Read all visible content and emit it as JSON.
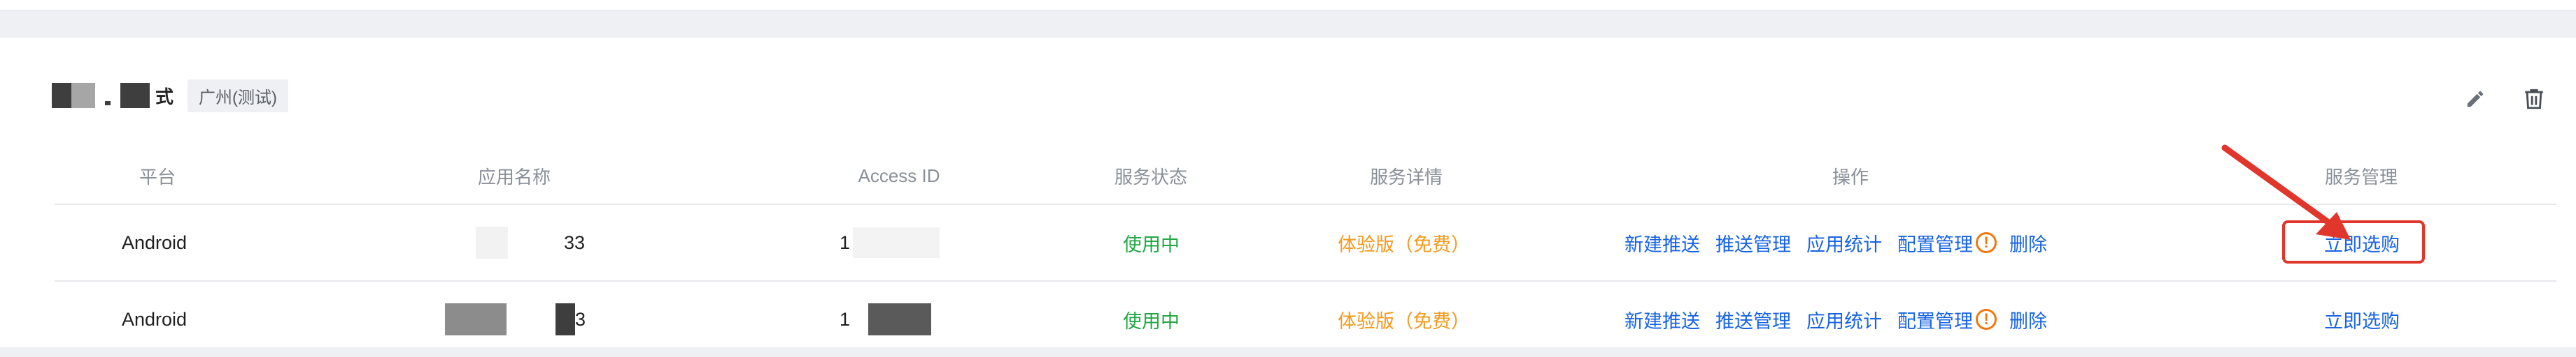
{
  "card": {
    "title_suffix": "式",
    "region_tag": "广州(测试)"
  },
  "table": {
    "headers": [
      "平台",
      "应用名称",
      "Access ID",
      "服务状态",
      "服务详情",
      "操作",
      "服务管理"
    ],
    "rows": [
      {
        "platform": "Android",
        "app_name_visible": "33",
        "access_id_visible": "1",
        "status": "使用中",
        "detail": "体验版（免费）",
        "ops": [
          "新建推送",
          "推送管理",
          "应用统计",
          "配置管理",
          "删除"
        ],
        "manage": "立即选购"
      },
      {
        "platform": "Android",
        "app_name_visible": "3",
        "access_id_visible": "1",
        "status": "使用中",
        "detail": "体验版（免费）",
        "ops": [
          "新建推送",
          "推送管理",
          "应用统计",
          "配置管理",
          "删除"
        ],
        "manage": "立即选购"
      }
    ]
  },
  "icons": {
    "edit": "pencil-icon",
    "delete": "trash-icon",
    "warning": "exclamation-circle-icon"
  },
  "colors": {
    "status": "#22a843",
    "detail": "#f29b1e",
    "link": "#1864e0",
    "warning": "#f0780f",
    "highlight": "#e0362c"
  }
}
